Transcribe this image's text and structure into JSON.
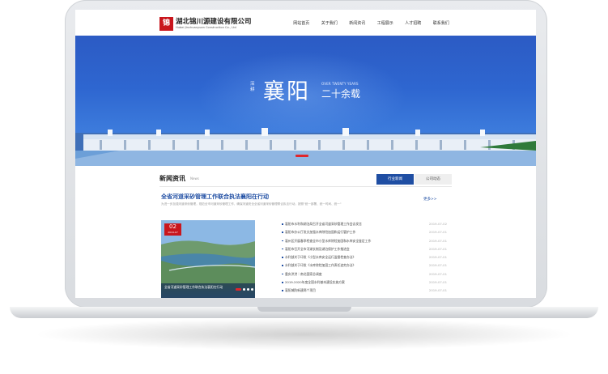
{
  "header": {
    "logo_mark": "锦川",
    "company_cn": "湖北锦川源建设有限公司",
    "company_en": "Hubei Jinchuanyuan Construction Co., Ltd",
    "nav": [
      "网站首页",
      "关于我们",
      "新闻资讯",
      "工程展示",
      "人才招聘",
      "联系我们"
    ]
  },
  "banner": {
    "vertical_text": "深耕",
    "title": "襄阳",
    "en_tagline": "OVER TWENTY YEARS",
    "subtitle": "二十余载"
  },
  "news": {
    "section_title": "新闻资讯",
    "section_sub": "News",
    "tabs": [
      {
        "label": "行业新闻",
        "active": true
      },
      {
        "label": "公司动态",
        "active": false
      }
    ],
    "headline": "全省河道采砂管理工作联合执法襄阳在行动",
    "headline_more": "更多>>",
    "headline_desc": "为进一步加强河道采砂管理，规范全市河道采砂管理工作，确保河道安全全省河道采砂管理联合执法行动，按照\"统一部署、统一时间、统一\"",
    "featured": {
      "day": "02",
      "year_month": "2019-07",
      "caption": "全省河道采砂管理工作联合执法襄阳在行动"
    },
    "items": [
      {
        "title": "襄阳市水利和湖泊局召开全省河道采砂管理工作会议发言",
        "date": "2019-07-02"
      },
      {
        "title": "襄阳市办公厅发文加强水库除险加固和运行管护工作",
        "date": "2019-07-01"
      },
      {
        "title": "襄州区开展春季检查全市小型水库除险加固和水库安全鉴定工作",
        "date": "2019-07-01"
      },
      {
        "title": "襄阳市召开全市河湖长制及湖泊保护工作推进会",
        "date": "2019-07-01"
      },
      {
        "title": "水利部关于印发《小型水库安全运行监督检查办法》",
        "date": "2019-07-01"
      },
      {
        "title": "水利部关于印发《水库除险加固工作责任追究办法》",
        "date": "2019-07-01"
      },
      {
        "title": "重庆洪涝｜南北国家总调度",
        "date": "2019-07-01"
      },
      {
        "title": "2019-2020年度全国水利基本建设实施方案",
        "date": "2019-07-01"
      },
      {
        "title": "襄阳城防新建两个项目",
        "date": "2019-07-01"
      }
    ]
  },
  "colors": {
    "brand_red": "#c9161d",
    "brand_blue": "#1f4ea3",
    "banner_blue": "#2e66d0"
  }
}
